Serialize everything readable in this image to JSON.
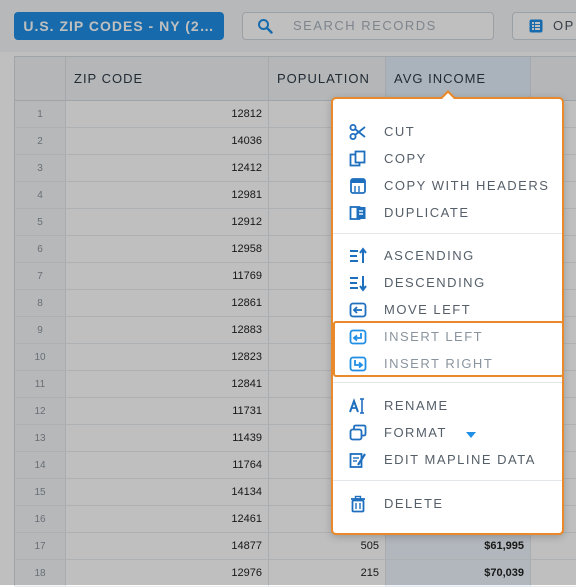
{
  "toolbar": {
    "dataset_label": "U.S. ZIP CODES - NY (2…",
    "search_placeholder": "SEARCH RECORDS",
    "options_label": "OP"
  },
  "table": {
    "columns": [
      "ZIP CODE",
      "POPULATION",
      "AVG INCOME"
    ],
    "rows": [
      {
        "n": "1",
        "zip": "12812",
        "pop": "",
        "inc": ""
      },
      {
        "n": "2",
        "zip": "14036",
        "pop": "",
        "inc": ""
      },
      {
        "n": "3",
        "zip": "12412",
        "pop": "",
        "inc": ""
      },
      {
        "n": "4",
        "zip": "12981",
        "pop": "",
        "inc": ""
      },
      {
        "n": "5",
        "zip": "12912",
        "pop": "",
        "inc": ""
      },
      {
        "n": "6",
        "zip": "12958",
        "pop": "",
        "inc": ""
      },
      {
        "n": "7",
        "zip": "11769",
        "pop": "",
        "inc": ""
      },
      {
        "n": "8",
        "zip": "12861",
        "pop": "",
        "inc": ""
      },
      {
        "n": "9",
        "zip": "12883",
        "pop": "",
        "inc": ""
      },
      {
        "n": "10",
        "zip": "12823",
        "pop": "",
        "inc": ""
      },
      {
        "n": "11",
        "zip": "12841",
        "pop": "",
        "inc": ""
      },
      {
        "n": "12",
        "zip": "11731",
        "pop": "",
        "inc": ""
      },
      {
        "n": "13",
        "zip": "11439",
        "pop": "",
        "inc": ""
      },
      {
        "n": "14",
        "zip": "11764",
        "pop": "",
        "inc": ""
      },
      {
        "n": "15",
        "zip": "14134",
        "pop": "",
        "inc": ""
      },
      {
        "n": "16",
        "zip": "12461",
        "pop": "",
        "inc": ""
      },
      {
        "n": "17",
        "zip": "14877",
        "pop": "505",
        "inc": "$61,995"
      },
      {
        "n": "18",
        "zip": "12976",
        "pop": "215",
        "inc": "$70,039"
      }
    ]
  },
  "menu": {
    "items": [
      {
        "label": "CUT",
        "icon": "scissors-icon"
      },
      {
        "label": "COPY",
        "icon": "copy-icon"
      },
      {
        "label": "COPY WITH HEADERS",
        "icon": "copy-with-headers-icon"
      },
      {
        "label": "DUPLICATE",
        "icon": "duplicate-icon"
      },
      {
        "label": "ASCENDING",
        "icon": "sort-ascending-icon"
      },
      {
        "label": "DESCENDING",
        "icon": "sort-descending-icon"
      },
      {
        "label": "MOVE LEFT",
        "icon": "move-left-icon"
      },
      {
        "label": "INSERT LEFT",
        "icon": "insert-left-icon"
      },
      {
        "label": "INSERT RIGHT",
        "icon": "insert-right-icon"
      },
      {
        "label": "RENAME",
        "icon": "rename-icon"
      },
      {
        "label": "FORMAT",
        "icon": "format-icon"
      },
      {
        "label": "EDIT MAPLINE DATA",
        "icon": "edit-data-icon"
      },
      {
        "label": "DELETE",
        "icon": "trash-icon"
      }
    ]
  },
  "colors": {
    "accent": "#1f8fe6",
    "highlight_border": "#e8892b"
  }
}
